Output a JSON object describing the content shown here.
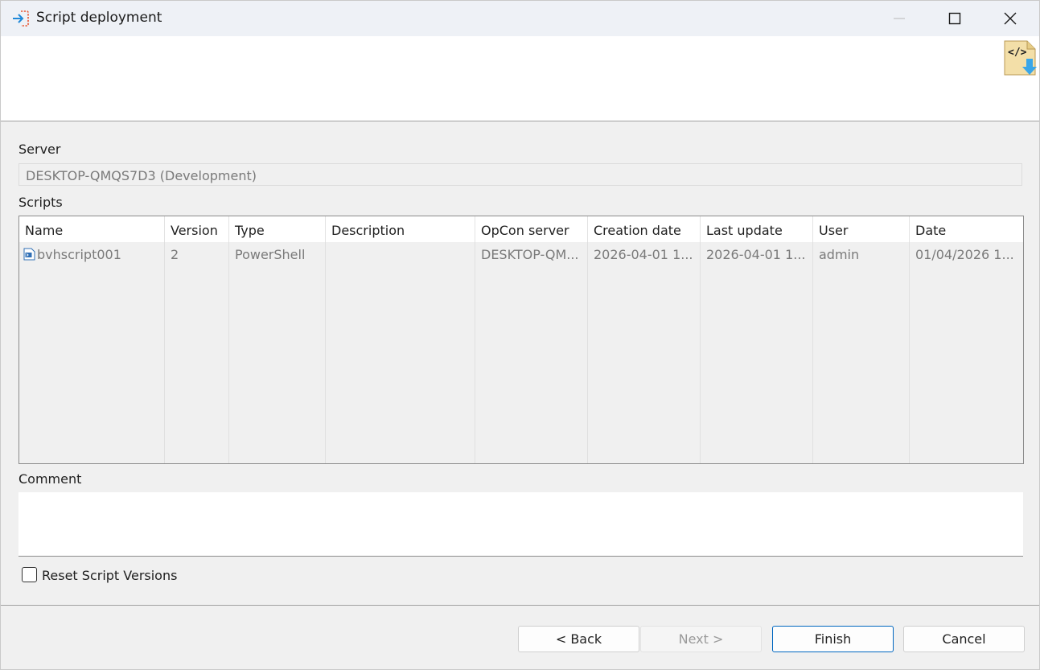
{
  "window": {
    "title": "Script deployment"
  },
  "form": {
    "server_label": "Server",
    "server_value": "DESKTOP-QMQS7D3 (Development)",
    "scripts_label": "Scripts",
    "comment_label": "Comment",
    "comment_value": "",
    "reset_label": "Reset Script Versions",
    "reset_checked": false
  },
  "table": {
    "columns": [
      "Name",
      "Version",
      "Type",
      "Description",
      "OpCon server",
      "Creation date",
      "Last update",
      "User",
      "Date"
    ],
    "rows": [
      {
        "name": "bvhscript001",
        "version": "2",
        "type": "PowerShell",
        "description": "",
        "opcon_server": "DESKTOP-QM...",
        "creation_date": "2026-04-01 1...",
        "last_update": "2026-04-01 1...",
        "user": "admin",
        "date": "01/04/2026 1..."
      }
    ]
  },
  "buttons": {
    "back": "< Back",
    "next": "Next >",
    "finish": "Finish",
    "cancel": "Cancel"
  },
  "icons": {
    "title": "import-arrow-icon",
    "banner": "script-deploy-icon",
    "row": "powershell-script-icon"
  },
  "colors": {
    "accent": "#0067c0",
    "titlebar": "#eef1f6",
    "background": "#f0f0f0"
  }
}
